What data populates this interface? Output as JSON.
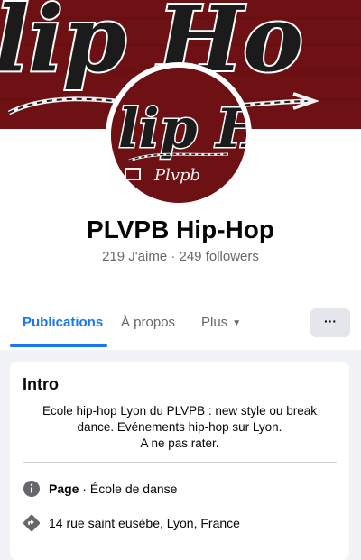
{
  "page": {
    "name": "PLVPB Hip-Hop",
    "stats": "219 J'aime · 249 followers"
  },
  "cover": {
    "script_text": "lip Ho",
    "accent_color": "#6e1114"
  },
  "avatar": {
    "script_text": "lip H",
    "sub_text": "Plvpb"
  },
  "tabs": [
    {
      "label": "Publications",
      "active": true
    },
    {
      "label": "À propos",
      "active": false
    },
    {
      "label": "Plus",
      "active": false
    }
  ],
  "more_button": {
    "label": "···"
  },
  "intro": {
    "title": "Intro",
    "bio_lines": [
      "Ecole hip-hop Lyon du PLVPB : new style ou break",
      "dance. Evénements hip-hop sur Lyon.",
      "A ne pas rater."
    ],
    "page_type_label": "Page",
    "page_type_value": " · École de danse",
    "address": "14 rue saint eusèbe, Lyon, France"
  },
  "icons": [
    "info-icon",
    "directions-icon",
    "chevron-down-icon",
    "more-icon"
  ],
  "colors": {
    "brand_blue": "#1877f2",
    "dark_red": "#6e1114",
    "secondary_text": "#65676b"
  }
}
